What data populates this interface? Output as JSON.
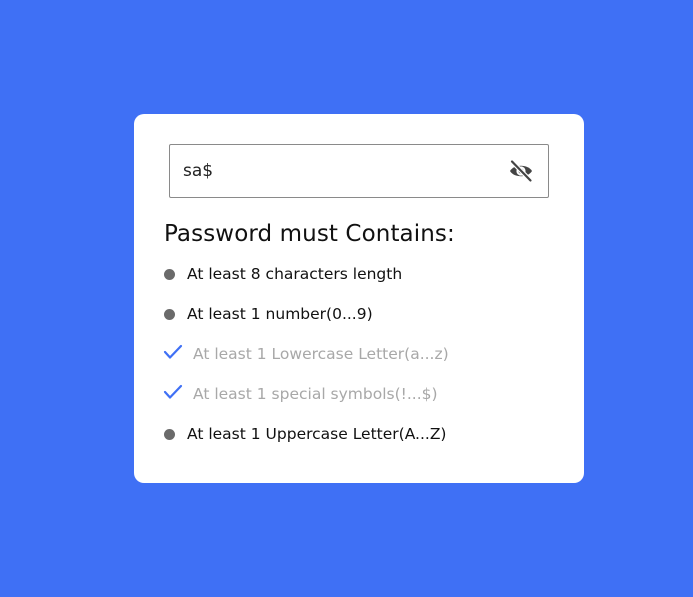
{
  "password": {
    "value": "sa$",
    "visibility_icon": "eye-slash-icon"
  },
  "heading": "Password must Contains:",
  "requirements": [
    {
      "label": "At least 8 characters length",
      "met": false
    },
    {
      "label": "At least 1 number(0...9)",
      "met": false
    },
    {
      "label": "At least 1 Lowercase Letter(a...z)",
      "met": true
    },
    {
      "label": "At least 1 special symbols(!...$)",
      "met": true
    },
    {
      "label": "At least 1 Uppercase Letter(A...Z)",
      "met": false
    }
  ],
  "colors": {
    "background": "#3f70f5",
    "card": "#ffffff",
    "check": "#3f70f5",
    "bullet": "#6a6a6a",
    "met_text": "#a8a8a8"
  }
}
